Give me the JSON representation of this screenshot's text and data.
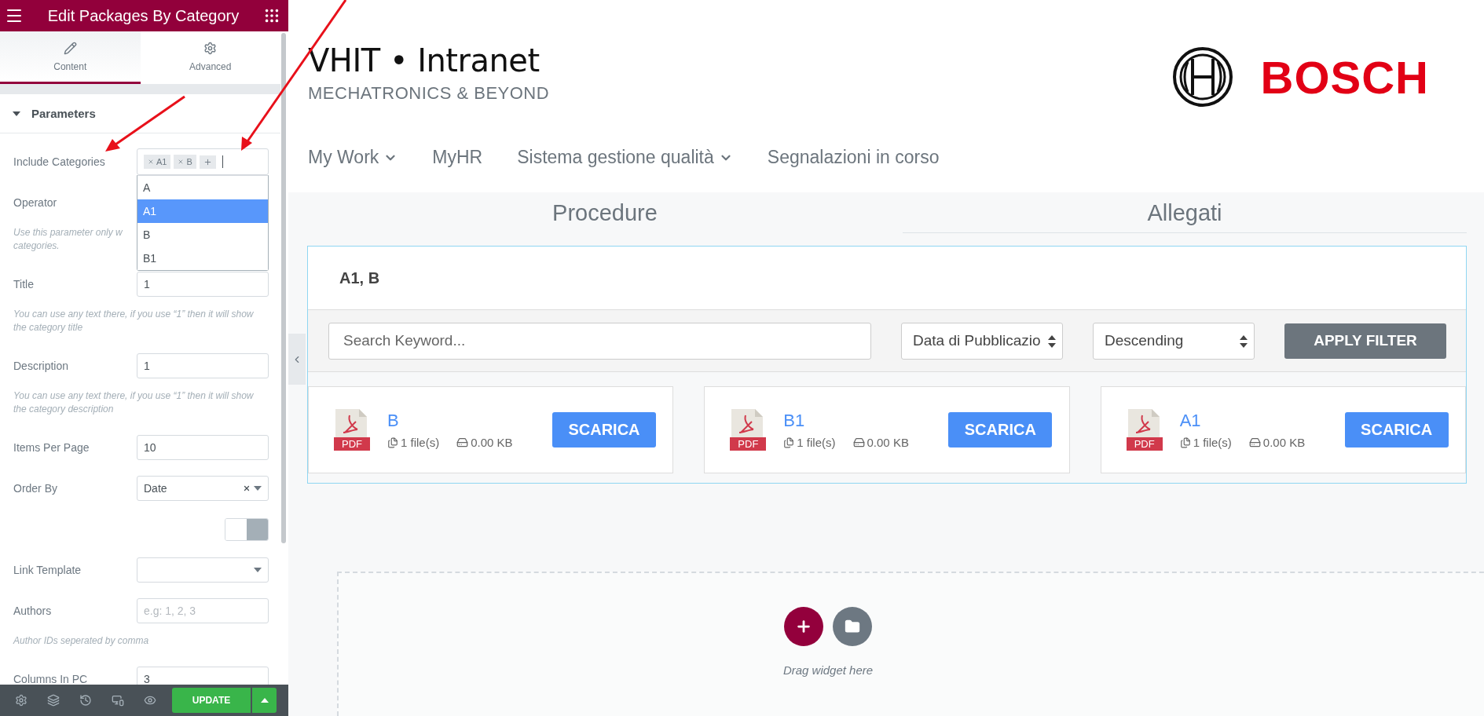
{
  "panel": {
    "title": "Edit Packages By Category",
    "tabs": [
      {
        "label": "Content",
        "selected": true
      },
      {
        "label": "Advanced",
        "selected": false
      }
    ],
    "section": {
      "title": "Parameters",
      "expanded": true
    },
    "controls": [
      {
        "kind": "tags",
        "label": "Include Categories",
        "tags": [
          "A1",
          "B"
        ],
        "options": [
          {
            "label": "A",
            "selected": false
          },
          {
            "label": "A1",
            "selected": true
          },
          {
            "label": "B",
            "selected": false
          },
          {
            "label": "B1",
            "selected": false
          }
        ]
      },
      {
        "kind": "label",
        "label": "Operator"
      },
      {
        "kind": "hint",
        "text": "Use this parameter only w\ncategories."
      },
      {
        "kind": "text",
        "label": "Title",
        "value": "1"
      },
      {
        "kind": "hint",
        "text": "You can use any text there, if you use “1” then it will show the category title"
      },
      {
        "kind": "text",
        "label": "Description",
        "value": "1"
      },
      {
        "kind": "hint",
        "text": "You can use any text there, if you use “1” then it will show the category description"
      },
      {
        "kind": "text",
        "label": "Items Per Page",
        "value": "10"
      },
      {
        "kind": "select",
        "label": "Order By",
        "value": "Date",
        "clearable": true
      },
      {
        "kind": "toggle",
        "on": false
      },
      {
        "kind": "select",
        "label": "Link Template"
      },
      {
        "kind": "text",
        "label": "Authors",
        "placeholder": "e.g: 1, 2, 3"
      },
      {
        "kind": "hint",
        "text": "Author IDs seperated by comma"
      },
      {
        "kind": "text",
        "label": "Columns In PC",
        "value": "3"
      }
    ],
    "footer": {
      "button": "UPDATE"
    }
  },
  "site": {
    "title": "VHIT • Intranet",
    "subtitle": "MECHATRONICS & BEYOND",
    "logo": "BOSCH",
    "nav": [
      {
        "label": "My Work",
        "dropdown": true
      },
      {
        "label": "MyHR",
        "dropdown": false
      },
      {
        "label": "Sistema gestione qualità",
        "dropdown": true
      },
      {
        "label": "Segnalazioni in corso",
        "dropdown": false
      }
    ],
    "tabs": [
      {
        "label": "Procedure",
        "selected": false
      },
      {
        "label": "Allegati",
        "selected": true
      }
    ],
    "widget": {
      "title": "A1, B",
      "search": {
        "placeholder": "Search Keyword..."
      },
      "selects": [
        "Data di Pubblicazio",
        "Descending"
      ],
      "button": "APPLY FILTER",
      "cards": [
        {
          "name": "B",
          "badge": "PDF",
          "files": "1 file(s)",
          "size": "0.00 KB",
          "button": "SCARICA"
        },
        {
          "name": "B1",
          "badge": "PDF",
          "files": "1 file(s)",
          "size": "0.00 KB",
          "button": "SCARICA"
        },
        {
          "name": "A1",
          "badge": "PDF",
          "files": "1 file(s)",
          "size": "0.00 KB",
          "button": "SCARICA"
        }
      ]
    },
    "dropzone": {
      "text": "Drag widget here"
    }
  }
}
